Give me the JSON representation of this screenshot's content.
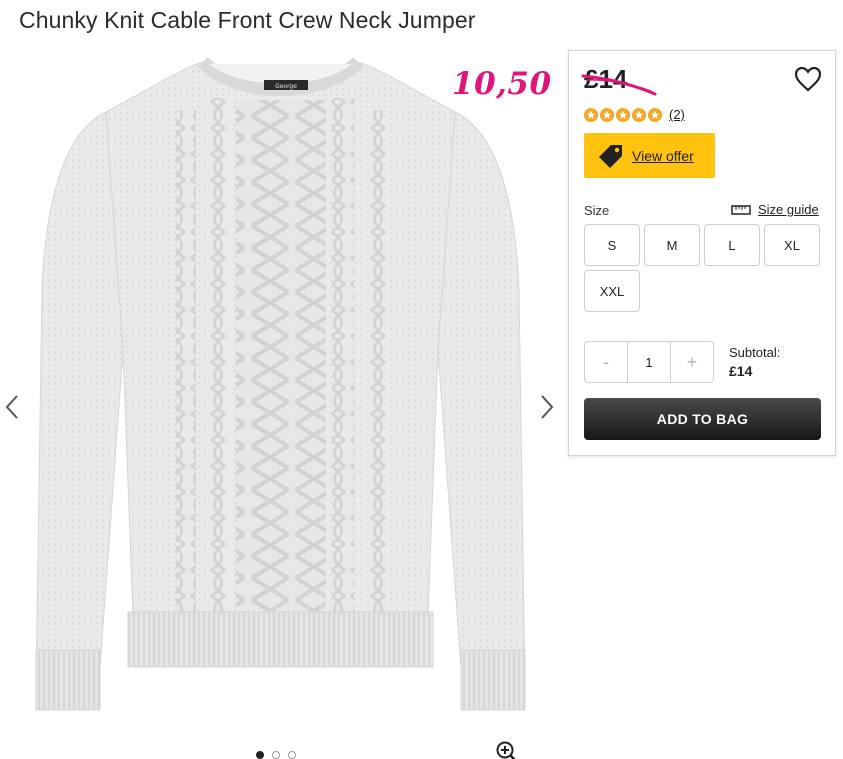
{
  "product": {
    "title": "Chunky Knit Cable Front Crew Neck Jumper",
    "price": "£14",
    "annotated_sale_price": "10,50",
    "rating": {
      "stars": 5,
      "count_label": "(2)"
    },
    "neck_label_text": "George"
  },
  "offer": {
    "label": "View offer",
    "color": "#ffc20e"
  },
  "sizes": {
    "label": "Size",
    "guide_label": "Size guide",
    "options": [
      "S",
      "M",
      "L",
      "XL",
      "XXL"
    ]
  },
  "quantity": {
    "minus": "-",
    "value": "1",
    "plus": "+"
  },
  "subtotal": {
    "label": "Subtotal:",
    "value": "£14"
  },
  "cart": {
    "add_label": "ADD TO BAG"
  },
  "gallery": {
    "image_count": 3,
    "active_index": 0
  },
  "colors": {
    "accent_pink": "#e0157a",
    "button_dark": "#222222",
    "offer_yellow": "#ffc20e"
  },
  "icons": [
    "heart-icon",
    "star-icon",
    "tag-icon",
    "ruler-icon",
    "chevron-left-icon",
    "chevron-right-icon",
    "zoom-in-icon"
  ]
}
